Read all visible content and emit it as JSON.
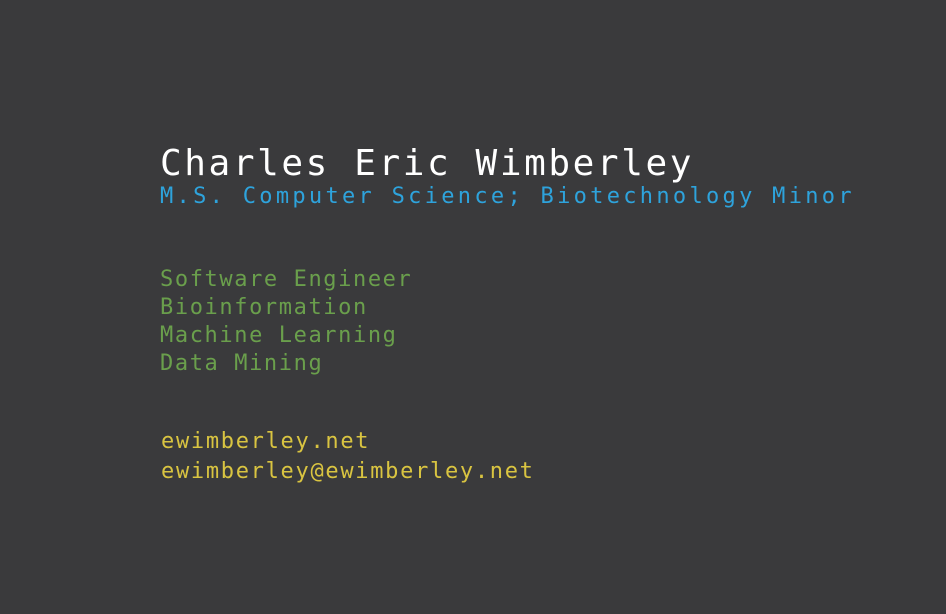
{
  "name": "Charles Eric Wimberley",
  "degree": "M.S. Computer Science; Biotechnology Minor",
  "skills": [
    "Software Engineer",
    "Bioinformation",
    "Machine Learning",
    "Data Mining"
  ],
  "contact": {
    "website": "ewimberley.net",
    "email": "ewimberley@ewimberley.net"
  },
  "colors": {
    "background": "#3a3a3c",
    "name": "#ffffff",
    "degree": "#2ea3dc",
    "skills": "#6a9f4c",
    "contact": "#d9c441"
  }
}
